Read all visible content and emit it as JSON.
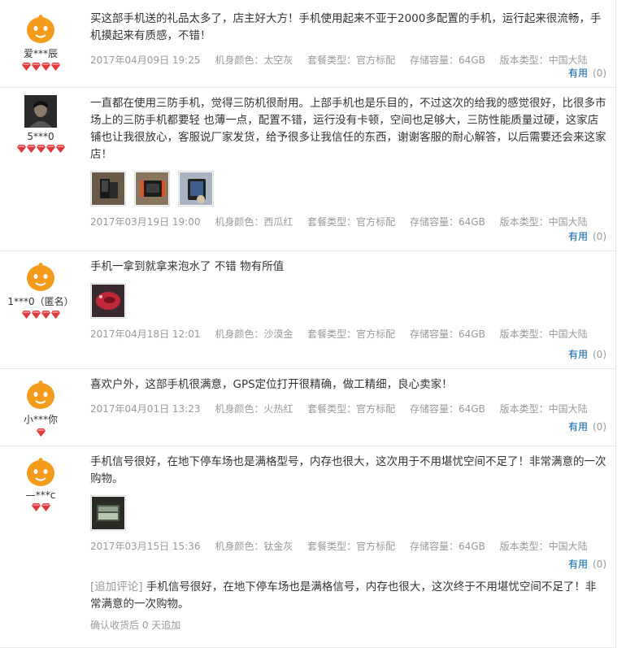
{
  "reviews": [
    {
      "nick": "爱***辰",
      "diamond_count": 4,
      "text": "买这部手机送的礼品太多了，店主好大方！手机使用起来不亚于2000多配置的手机，运行起来很流畅，手机摸起来有质感，不错！",
      "date": "2017年04月09日 19:25",
      "color": "机身颜色：太空灰",
      "package": "套餐类型：官方标配",
      "storage": "存储容量：64GB",
      "version": "版本类型：中国大陆",
      "useful_label": "有用",
      "useful_count": "(0)"
    },
    {
      "nick": "5***0",
      "diamond_count": 5,
      "text": "一直都在使用三防手机，觉得三防机很耐用。上部手机也是乐目的，不过这次的给我的感觉很好，比很多市场上的三防手机都要轻 也薄一点，配置不错，运行没有卡顿，空间也足够大，三防性能质量过硬，这家店铺也让我很放心，客服说厂家发货，给予很多让我信任的东西，谢谢客服的耐心解答，以后需要还会来这家店！",
      "date": "2017年03月19日 19:00",
      "color": "机身颜色：西瓜红",
      "package": "套餐类型：官方标配",
      "storage": "存储容量：64GB",
      "version": "版本类型：中国大陆",
      "useful_label": "有用",
      "useful_count": "(0)"
    },
    {
      "nick": "1***0（匿名）",
      "diamond_count": 4,
      "text": "手机一拿到就拿来泡水了 不错 物有所值",
      "date": "2017年04月18日 12:01",
      "color": "机身颜色：沙漠金",
      "package": "套餐类型：官方标配",
      "storage": "存储容量：64GB",
      "version": "版本类型：中国大陆",
      "useful_label": "有用",
      "useful_count": "(0)"
    },
    {
      "nick": "小***你",
      "diamond_count": 1,
      "text": "喜欢户外，这部手机很满意，GPS定位打开很精确，做工精细，良心卖家！",
      "date": "2017年04月01日 13:23",
      "color": "机身颜色：火热红",
      "package": "套餐类型：官方标配",
      "storage": "存储容量：64GB",
      "version": "版本类型：中国大陆",
      "useful_label": "有用",
      "useful_count": "(0)"
    },
    {
      "nick": "—***c",
      "diamond_count": 2,
      "text": "手机信号很好，在地下停车场也是满格型号，内存也很大，这次用于不用堪忧空间不足了！非常满意的一次购物。",
      "date": "2017年03月15日 15:36",
      "color": "机身颜色：钛金灰",
      "package": "套餐类型：官方标配",
      "storage": "存储容量：64GB",
      "version": "版本类型：中国大陆",
      "useful_label": "有用",
      "useful_count": "(0)",
      "append_tag": "[追加评论]",
      "append_text": "手机信号很好，在地下停车场也是满格信号，内存也很大，这次终于不用堪忧空间不足了！非常满意的一次购物。",
      "append_after": "确认收货后 0 天追加"
    }
  ],
  "colors": {
    "link": "#005ea7",
    "meta": "#999999",
    "diamond": "#e4393c"
  }
}
